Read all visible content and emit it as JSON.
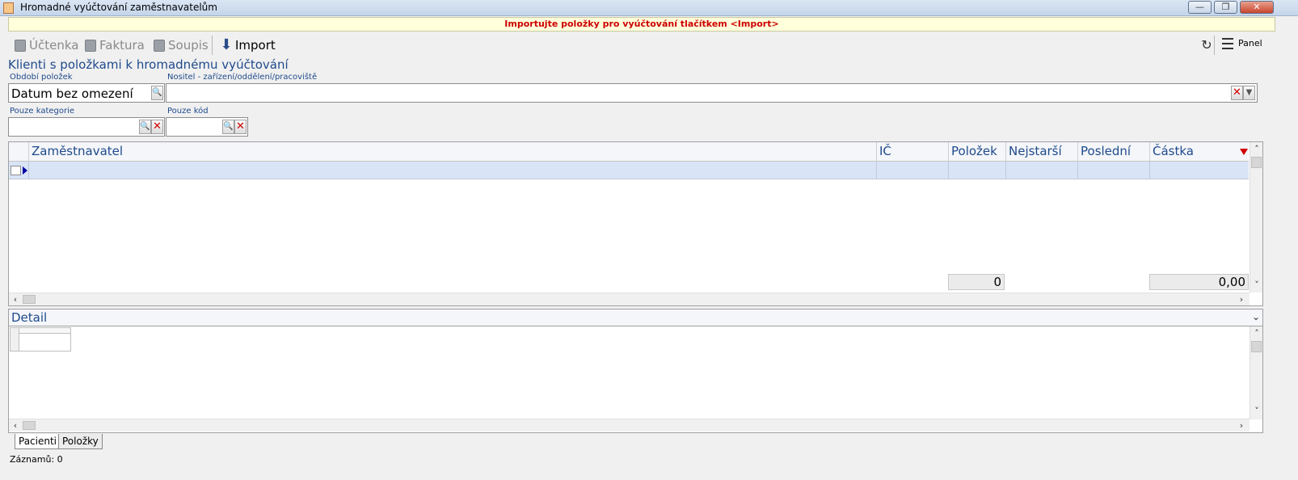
{
  "window": {
    "title": "Hromadné vyúčtování zaměstnavatelům",
    "minimize_label": "—",
    "maximize_label": "❐",
    "close_label": "✕"
  },
  "banner": {
    "text": "Importujte položky pro vyúčtování tlačítkem <Import>"
  },
  "toolbar": {
    "receipt_label": "Účtenka",
    "invoice_label": "Faktura",
    "list_label": "Soupis",
    "import_label": "Import",
    "panel_label": "Panel"
  },
  "section": {
    "title": "Klienti s položkami k hromadnému vyúčtování"
  },
  "filters": {
    "period_label": "Období položek",
    "period_value": "Datum bez omezení",
    "carrier_label": "Nositel - zařízení/oddělení/pracoviště",
    "carrier_value": "",
    "category_label": "Pouze kategorie",
    "category_value": "",
    "code_label": "Pouze kód",
    "code_value": ""
  },
  "grid": {
    "columns": [
      "Zaměstnavatel",
      "IČ",
      "Položek",
      "Nejstarší",
      "Poslední",
      "Částka"
    ],
    "rows": [],
    "totals": {
      "items": "0",
      "amount": "0,00"
    }
  },
  "detail": {
    "title": "Detail"
  },
  "tabs": [
    "Pacienti",
    "Položky"
  ],
  "status": {
    "records": "Záznamů: 0"
  }
}
